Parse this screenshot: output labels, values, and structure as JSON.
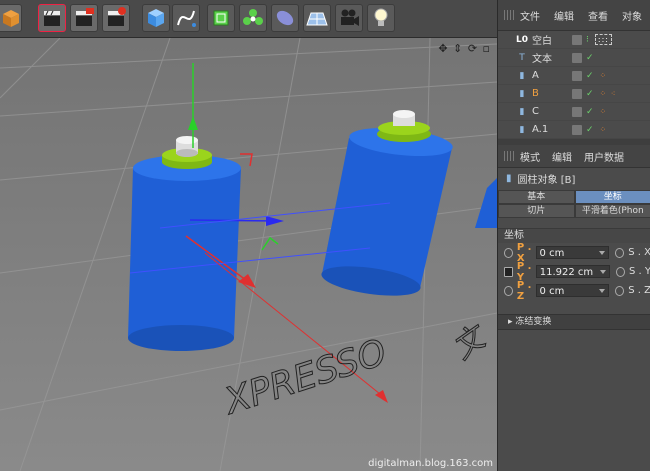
{
  "toolbar": {
    "icons": [
      "cube-icon",
      "clapper-icon",
      "clapper-edit-icon",
      "clapper-settings-icon",
      "cube-primitive-icon",
      "spline-icon",
      "subdivision-icon",
      "cloner-icon",
      "deformer-icon",
      "floor-icon",
      "camera-icon",
      "light-icon"
    ]
  },
  "viewport": {
    "watermark": "digitalman.blog.163.com",
    "text3d": "XPRESSO",
    "text3d_b": "文"
  },
  "object_manager": {
    "menu": [
      "文件",
      "编辑",
      "查看",
      "对象"
    ],
    "objects": [
      {
        "name": "空白",
        "icon": "null-icon",
        "prefix": "L0"
      },
      {
        "name": "文本",
        "icon": "text-icon",
        "prefix": "T"
      },
      {
        "name": "A",
        "icon": "cylinder-icon"
      },
      {
        "name": "B",
        "icon": "cylinder-icon",
        "selected": true
      },
      {
        "name": "C",
        "icon": "cylinder-icon"
      },
      {
        "name": "A.1",
        "icon": "cylinder-icon"
      }
    ]
  },
  "attributes": {
    "menu": [
      "模式",
      "编辑",
      "用户数据"
    ],
    "object_title": "圆柱对象 [B]",
    "tabs": [
      "基本",
      "坐标"
    ],
    "tabs2": [
      "切片",
      "平滑着色(Phon"
    ],
    "section": "坐标",
    "coords": [
      {
        "label": "P . X",
        "value": "0 cm",
        "s_label": "S . X"
      },
      {
        "label": "P . Y",
        "value": "11.922 cm",
        "s_label": "S . Y"
      },
      {
        "label": "P . Z",
        "value": "0 cm",
        "s_label": "S . Z"
      }
    ],
    "frozen": "冻结变换"
  },
  "colors": {
    "cylinder": "#1f5fd6",
    "cap_green": "#9bd41c",
    "accent_orange": "#f0a040"
  }
}
